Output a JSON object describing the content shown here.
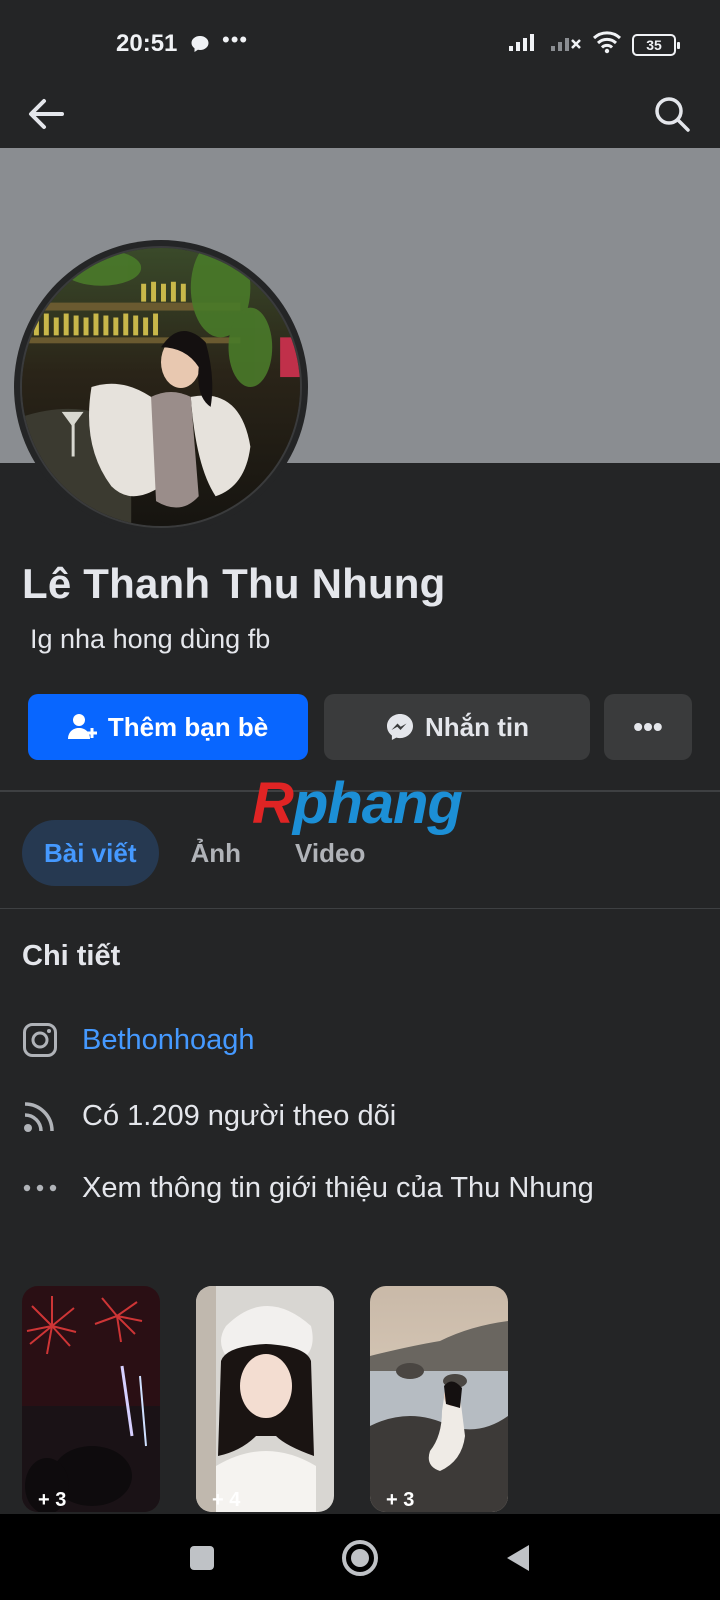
{
  "status_bar": {
    "time": "20:51",
    "dots": "•••",
    "battery": "35"
  },
  "profile": {
    "name": "Lê Thanh Thu Nhung",
    "bio": "Ig nha hong dùng fb"
  },
  "actions": {
    "add_friend": "Thêm bạn bè",
    "message": "Nhắn tin",
    "more": "•••"
  },
  "watermark": {
    "part1": "R",
    "part2": "phang"
  },
  "tabs": [
    {
      "label": "Bài viết",
      "active": true
    },
    {
      "label": "Ảnh",
      "active": false
    },
    {
      "label": "Video",
      "active": false
    }
  ],
  "details": {
    "title": "Chi tiết",
    "instagram": "Bethonhoagh",
    "followers": "Có 1.209 người theo dõi",
    "more_info": "Xem thông tin giới thiệu của Thu Nhung"
  },
  "highlights": [
    {
      "count": "+ 3",
      "icon": "fireworks-thumbnail"
    },
    {
      "count": "+ 4",
      "icon": "portrait-thumbnail"
    },
    {
      "count": "+ 3",
      "icon": "beach-thumbnail"
    }
  ],
  "colors": {
    "background": "#242526",
    "accent": "#0866ff",
    "link": "#4599ff",
    "cover": "#8a8d91"
  }
}
